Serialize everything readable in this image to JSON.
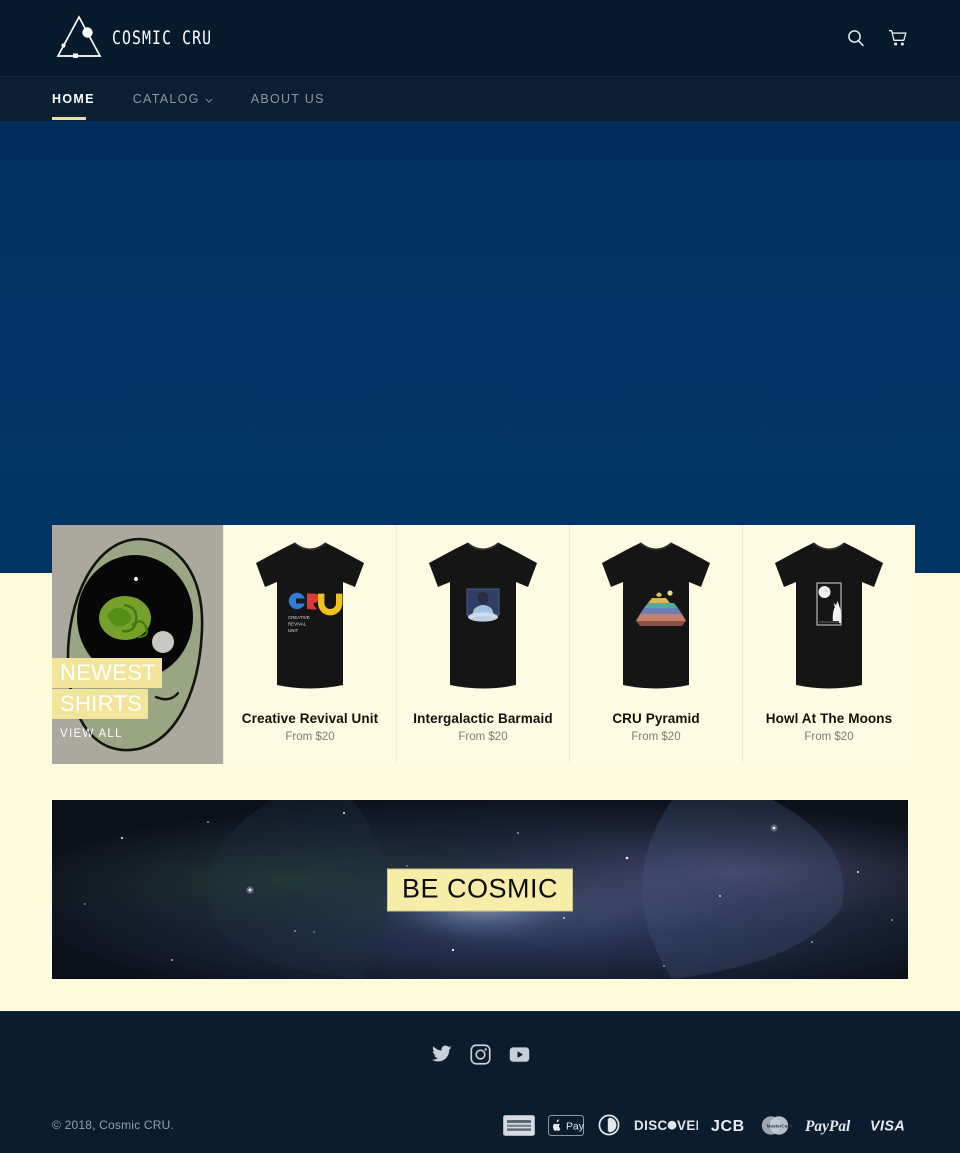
{
  "header": {
    "brand_name": "COSMIC CRU",
    "logo_icon": "cosmic-triangle-logo",
    "search_icon": "search-icon",
    "cart_icon": "shopping-cart-icon",
    "background_color": "#061a2e"
  },
  "nav": {
    "items": [
      {
        "label": "HOME",
        "active": true,
        "has_dropdown": false
      },
      {
        "label": "CATALOG",
        "active": false,
        "has_dropdown": true
      },
      {
        "label": "ABOUT US",
        "active": false,
        "has_dropdown": false
      }
    ],
    "active_underline_color": "#e8dfa0",
    "background_color": "#0a1f33"
  },
  "hero": {
    "background_color": "#02305e"
  },
  "promo": {
    "title_line1": "NEWEST",
    "title_line2": "SHIRTS",
    "view_all_label": "VIEW ALL",
    "highlight_color": "#f2e59b",
    "art_name": "alien-head-illustration"
  },
  "products": [
    {
      "title": "Creative Revival Unit",
      "price": "From $20",
      "art": "cru-logo-shirt"
    },
    {
      "title": "Intergalactic Barmaid",
      "price": "From $20",
      "art": "barmaid-shirt"
    },
    {
      "title": "CRU Pyramid",
      "price": "From $20",
      "art": "pyramid-shirt"
    },
    {
      "title": "Howl At The Moons",
      "price": "From $20",
      "art": "wolf-moon-shirt"
    }
  ],
  "banner": {
    "text": "BE COSMIC",
    "text_background": "#f8eda8",
    "art_name": "nebula-space-image"
  },
  "footer": {
    "social": [
      {
        "name": "twitter-icon",
        "label": "Twitter"
      },
      {
        "name": "instagram-icon",
        "label": "Instagram"
      },
      {
        "name": "youtube-icon",
        "label": "YouTube"
      }
    ],
    "copyright": "© 2018, Cosmic CRU.",
    "payments": [
      "american express",
      "apple pay",
      "diners club",
      "discover",
      "jcb",
      "master",
      "paypal",
      "visa"
    ],
    "background_color": "#0b1c2e"
  },
  "page": {
    "background_color": "#fcfbdc"
  }
}
